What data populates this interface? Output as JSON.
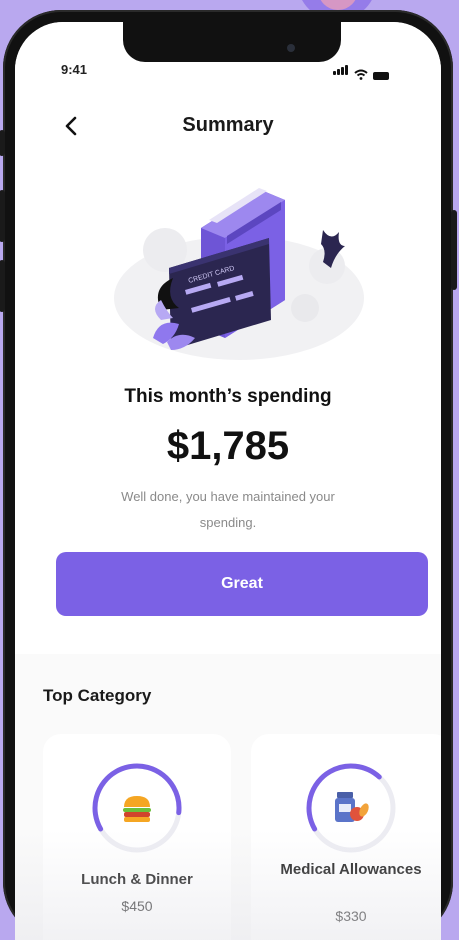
{
  "status_bar": {
    "time": "9:41"
  },
  "header": {
    "title": "Summary"
  },
  "summary": {
    "subtitle": "This month’s spending",
    "amount": "$1,785",
    "message": "Well done, you have maintained your spending.",
    "button_label": "Great"
  },
  "illustration": {
    "card_text": "CREDIT CARD"
  },
  "top_category": {
    "title": "Top Category",
    "items": [
      {
        "name": "Lunch & Dinner",
        "amount": "$450",
        "icon": "burger-icon",
        "ring_fraction": 0.6
      },
      {
        "name": "Medical Allowances",
        "amount": "$330",
        "icon": "medicine-icon",
        "ring_fraction": 0.45
      }
    ]
  },
  "colors": {
    "accent": "#7b61e5",
    "background": "#b9a8ef"
  }
}
